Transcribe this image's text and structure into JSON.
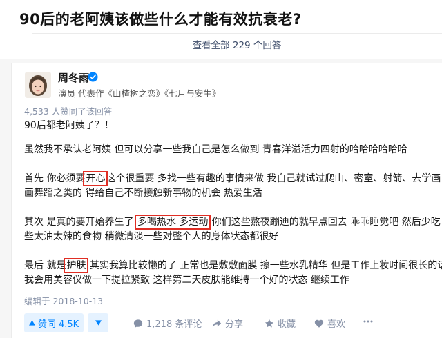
{
  "question": {
    "title": "90后的老阿姨该做些什么才能有效抗衰老?",
    "view_all_label": "查看全部 229 个回答"
  },
  "author": {
    "name": "周冬雨",
    "bio": "演员 代表作《山楂树之恋》《七月与安生》",
    "verified_icon": "verified-badge-icon"
  },
  "answer": {
    "upvote_summary": "4,533 人赞同了该回答",
    "p0": "90后都老阿姨了？！",
    "p1": "虽然我不承认老阿姨 但可以分享一些我自己是怎么做到 青春洋溢活力四射的哈哈哈哈哈哈",
    "p2": {
      "a": "首先 你必须要",
      "hl": "开心",
      "b": "这个很重要 多找一些有趣的事情来做 我自己就试过爬山、密室、射箭、去学画",
      "line2": "画舞蹈之类的 得给自己不断接触新事物的机会 热爱生活"
    },
    "p3": {
      "a": "其次 是真的要开始养生了 ",
      "hl": "多喝热水 多运动",
      "b": " 你们这些熬夜蹦迪的就早点回去 乖乖睡觉吧 然后少吃",
      "line2": "些太油太辣的食物 稍微清淡一些对整个人的身体状态都很好"
    },
    "p4": {
      "a": "最后 就是",
      "hl": "护肤",
      "b": " 其实我算比较懒的了 正常也是敷敷面膜 擦一些水乳精华 但是工作上妆时间很长的话",
      "line2": "我会用美容仪做一下提拉紧致 这样第二天皮肤能维持一个好的状态 继续工作"
    },
    "edit_date": "编辑于 2018-10-13"
  },
  "actions": {
    "upvote_label": "赞同 4.5K",
    "comments_label": "1,218 条评论",
    "share_label": "分享",
    "favorite_label": "收藏",
    "like_label": "喜欢"
  },
  "colors": {
    "accent": "#0084ff",
    "highlight_box": "#e02e24",
    "muted": "#8590a6"
  }
}
